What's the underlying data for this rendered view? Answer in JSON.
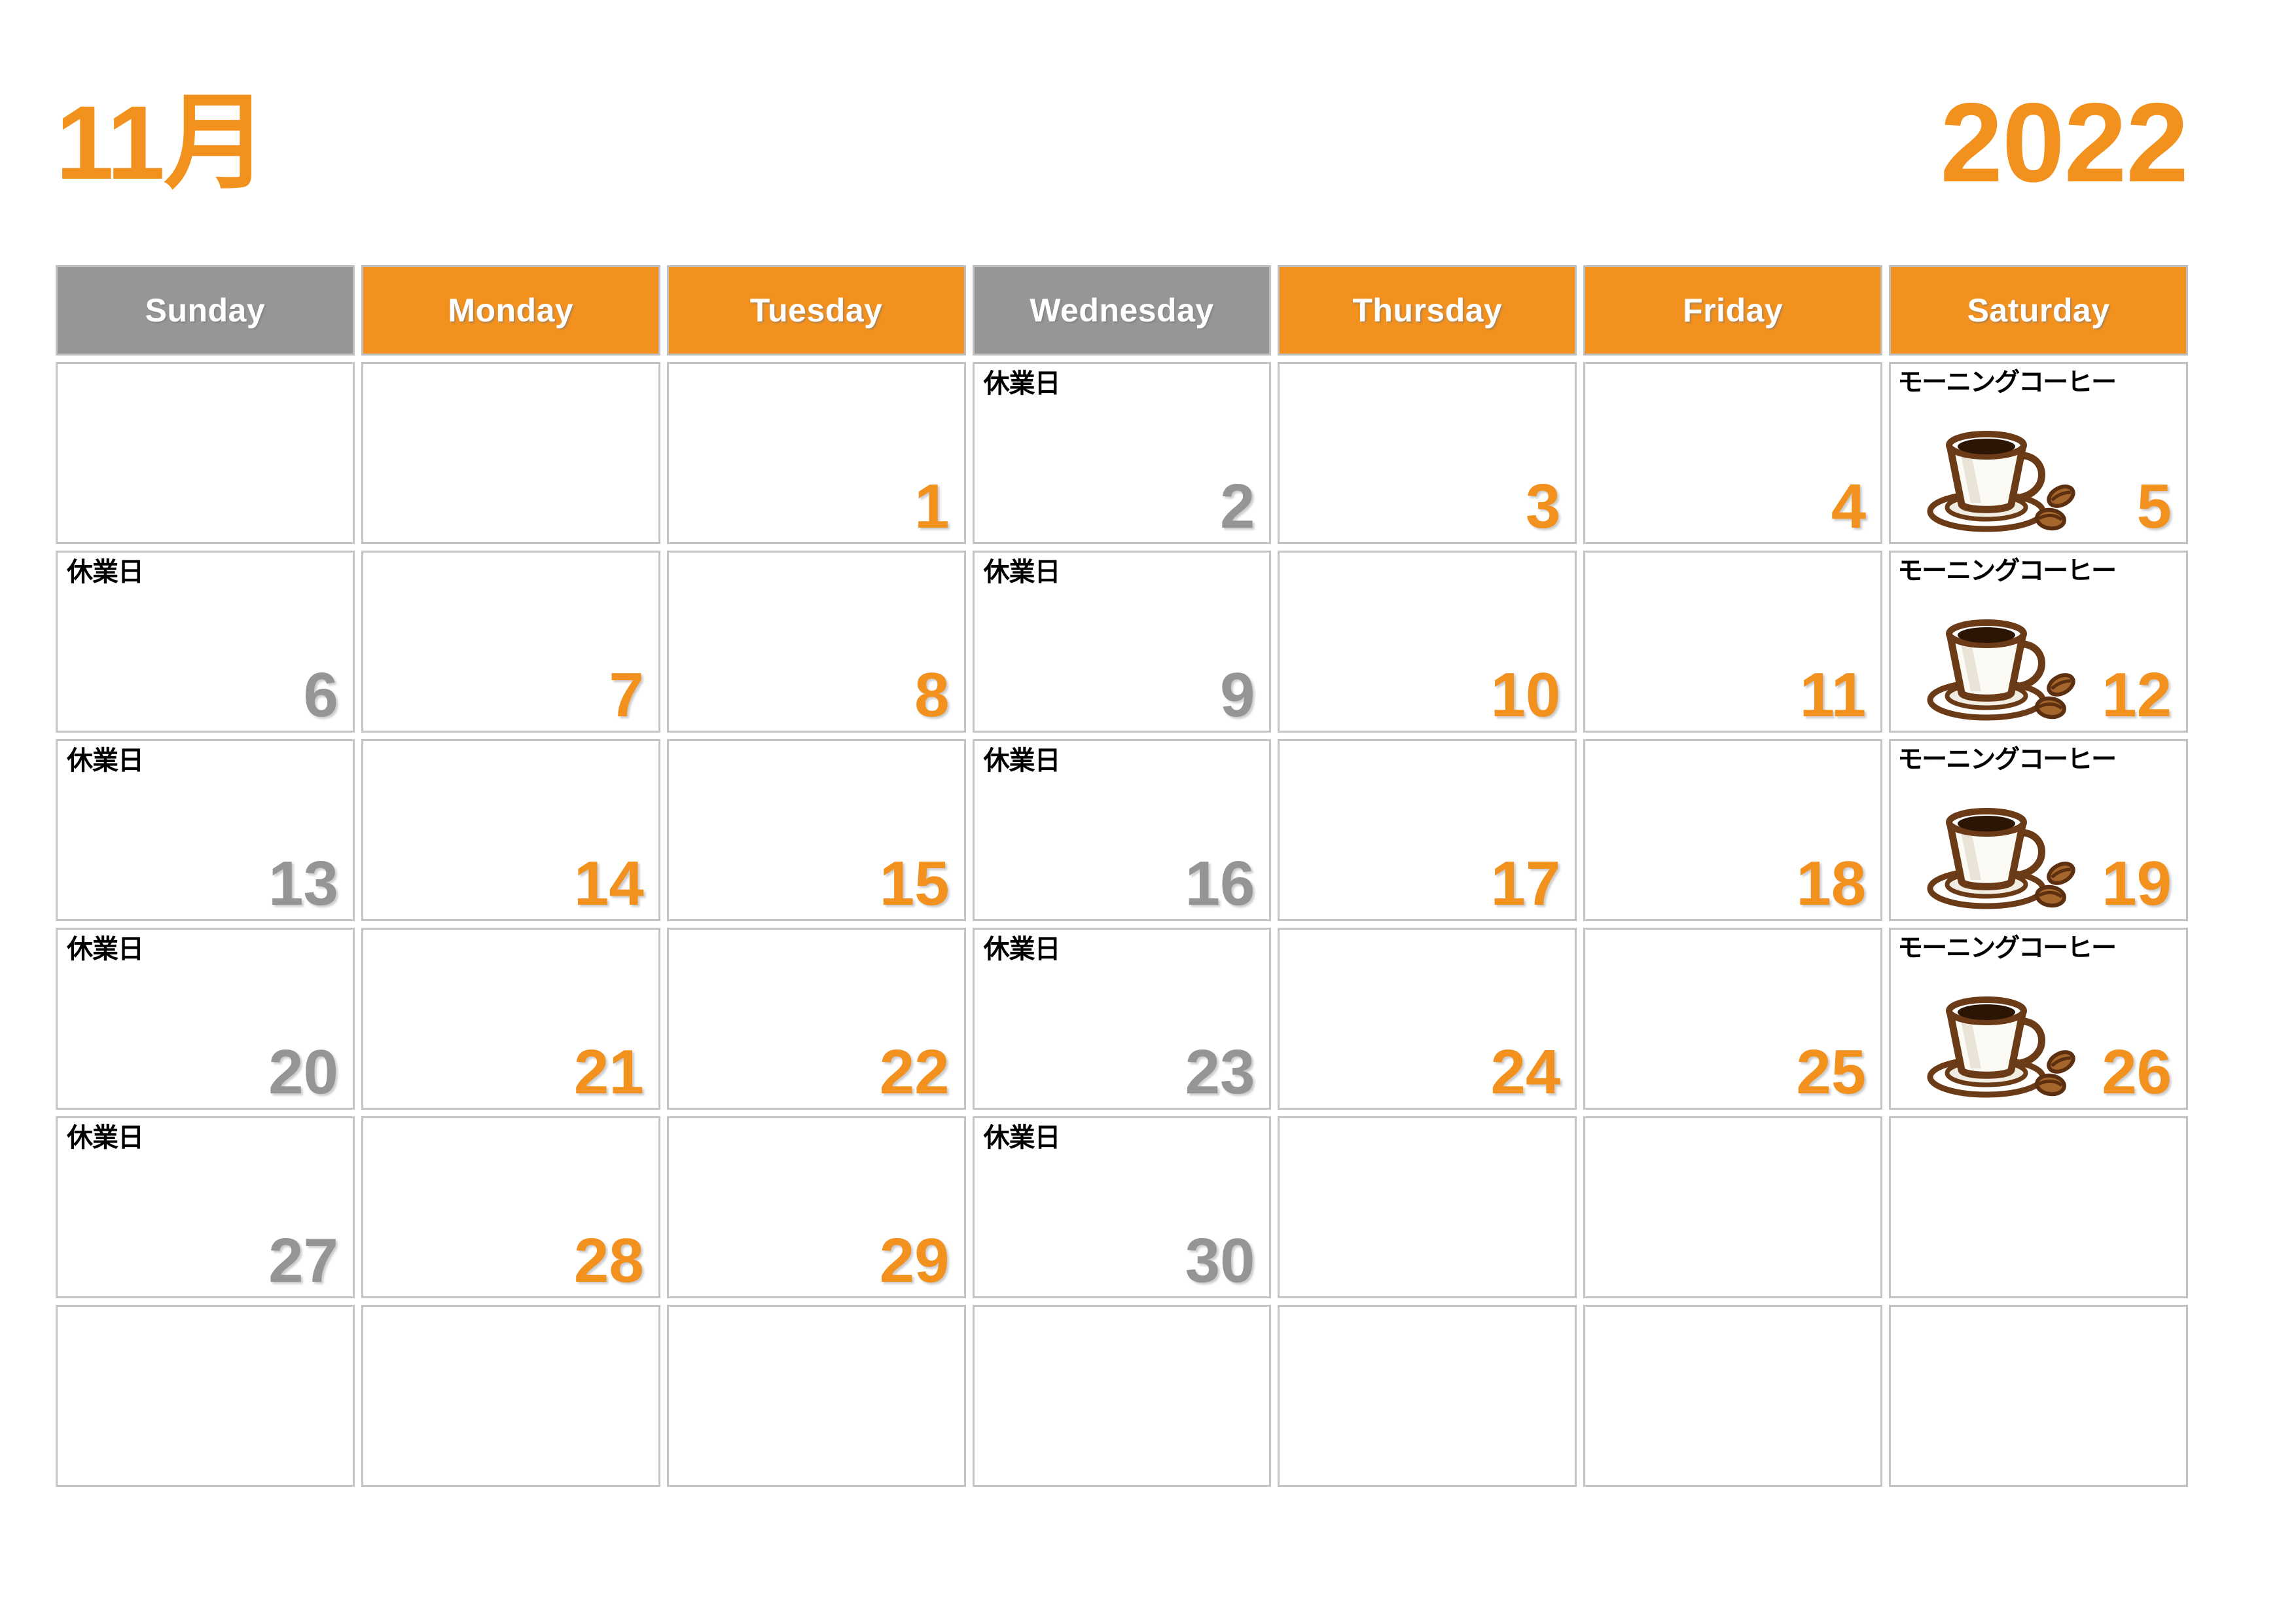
{
  "header": {
    "month_label": "11月",
    "year_label": "2022",
    "accent_color": "#F2911E",
    "gray_color": "#969696"
  },
  "weekdays": [
    {
      "label": "Sunday",
      "style": "gray"
    },
    {
      "label": "Monday",
      "style": "orange"
    },
    {
      "label": "Tuesday",
      "style": "orange"
    },
    {
      "label": "Wednesday",
      "style": "gray"
    },
    {
      "label": "Thursday",
      "style": "orange"
    },
    {
      "label": "Friday",
      "style": "orange"
    },
    {
      "label": "Saturday",
      "style": "orange"
    }
  ],
  "notes": {
    "closed": "休業日",
    "morning_coffee": "モーニングコーヒー"
  },
  "icons": {
    "coffee": "coffee-cup-icon"
  },
  "cells": [
    {
      "date": "",
      "note": "",
      "style": "",
      "icon": ""
    },
    {
      "date": "",
      "note": "",
      "style": "",
      "icon": ""
    },
    {
      "date": "1",
      "note": "",
      "style": "orange",
      "icon": ""
    },
    {
      "date": "2",
      "note": "休業日",
      "style": "gray",
      "icon": ""
    },
    {
      "date": "3",
      "note": "",
      "style": "orange",
      "icon": ""
    },
    {
      "date": "4",
      "note": "",
      "style": "orange",
      "icon": ""
    },
    {
      "date": "5",
      "note": "モーニングコーヒー",
      "style": "orange",
      "icon": "coffee"
    },
    {
      "date": "6",
      "note": "休業日",
      "style": "gray",
      "icon": ""
    },
    {
      "date": "7",
      "note": "",
      "style": "orange",
      "icon": ""
    },
    {
      "date": "8",
      "note": "",
      "style": "orange",
      "icon": ""
    },
    {
      "date": "9",
      "note": "休業日",
      "style": "gray",
      "icon": ""
    },
    {
      "date": "10",
      "note": "",
      "style": "orange",
      "icon": ""
    },
    {
      "date": "11",
      "note": "",
      "style": "orange",
      "icon": ""
    },
    {
      "date": "12",
      "note": "モーニングコーヒー",
      "style": "orange",
      "icon": "coffee"
    },
    {
      "date": "13",
      "note": "休業日",
      "style": "gray",
      "icon": ""
    },
    {
      "date": "14",
      "note": "",
      "style": "orange",
      "icon": ""
    },
    {
      "date": "15",
      "note": "",
      "style": "orange",
      "icon": ""
    },
    {
      "date": "16",
      "note": "休業日",
      "style": "gray",
      "icon": ""
    },
    {
      "date": "17",
      "note": "",
      "style": "orange",
      "icon": ""
    },
    {
      "date": "18",
      "note": "",
      "style": "orange",
      "icon": ""
    },
    {
      "date": "19",
      "note": "モーニングコーヒー",
      "style": "orange",
      "icon": "coffee"
    },
    {
      "date": "20",
      "note": "休業日",
      "style": "gray",
      "icon": ""
    },
    {
      "date": "21",
      "note": "",
      "style": "orange",
      "icon": ""
    },
    {
      "date": "22",
      "note": "",
      "style": "orange",
      "icon": ""
    },
    {
      "date": "23",
      "note": "休業日",
      "style": "gray",
      "icon": ""
    },
    {
      "date": "24",
      "note": "",
      "style": "orange",
      "icon": ""
    },
    {
      "date": "25",
      "note": "",
      "style": "orange",
      "icon": ""
    },
    {
      "date": "26",
      "note": "モーニングコーヒー",
      "style": "orange",
      "icon": "coffee"
    },
    {
      "date": "27",
      "note": "休業日",
      "style": "gray",
      "icon": ""
    },
    {
      "date": "28",
      "note": "",
      "style": "orange",
      "icon": ""
    },
    {
      "date": "29",
      "note": "",
      "style": "orange",
      "icon": ""
    },
    {
      "date": "30",
      "note": "休業日",
      "style": "gray",
      "icon": ""
    },
    {
      "date": "",
      "note": "",
      "style": "",
      "icon": ""
    },
    {
      "date": "",
      "note": "",
      "style": "",
      "icon": ""
    },
    {
      "date": "",
      "note": "",
      "style": "",
      "icon": ""
    },
    {
      "date": "",
      "note": "",
      "style": "",
      "icon": ""
    },
    {
      "date": "",
      "note": "",
      "style": "",
      "icon": ""
    },
    {
      "date": "",
      "note": "",
      "style": "",
      "icon": ""
    },
    {
      "date": "",
      "note": "",
      "style": "",
      "icon": ""
    },
    {
      "date": "",
      "note": "",
      "style": "",
      "icon": ""
    },
    {
      "date": "",
      "note": "",
      "style": "",
      "icon": ""
    },
    {
      "date": "",
      "note": "",
      "style": "",
      "icon": ""
    }
  ]
}
